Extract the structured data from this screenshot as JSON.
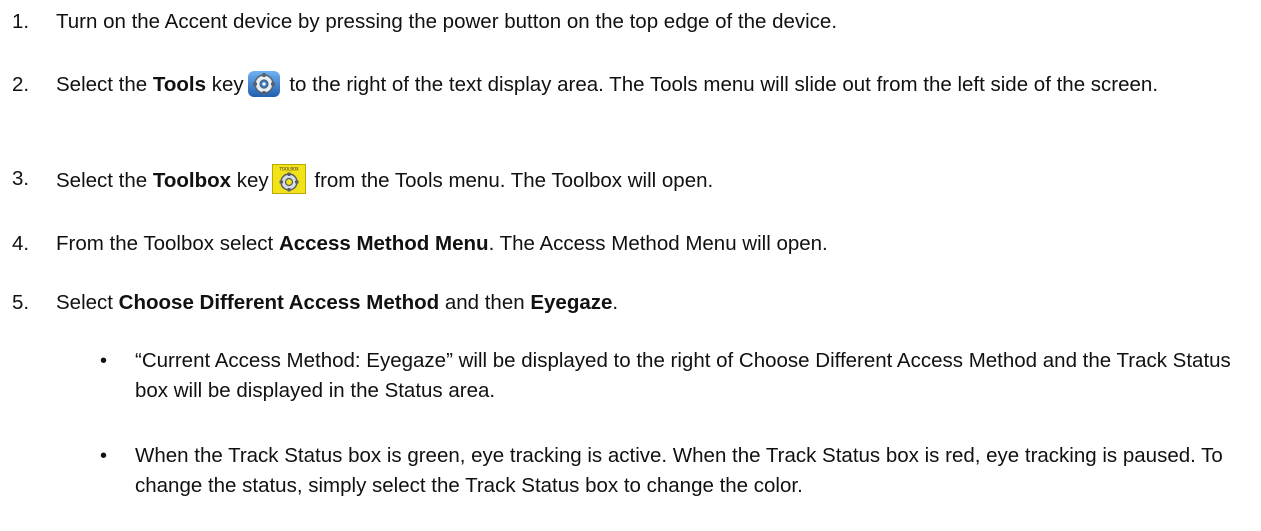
{
  "steps": [
    {
      "number": "1.",
      "text": "Turn on the Accent device by pressing the power button on the top edge of the device."
    },
    {
      "number": "2.",
      "pre": "Select the ",
      "bold": "Tools",
      "mid": " key",
      "icon": "tools-gear-icon",
      "post": " to the right of the text display area. The Tools menu will slide out from the left side of the screen."
    },
    {
      "number": "3.",
      "pre": "Select the ",
      "bold": "Toolbox",
      "mid": " key",
      "icon": "toolbox-key-icon",
      "icon_caption": "TOOLBOX",
      "post": " from the Tools menu. The Toolbox will open."
    },
    {
      "number": "4.",
      "pre": "From the Toolbox select ",
      "bold": "Access Method Menu",
      "post": ". The Access Method Menu will open."
    },
    {
      "number": "5.",
      "pre": "Select ",
      "bold": "Choose Different Access Method",
      "mid": " and then ",
      "bold2": "Eyegaze",
      "post": "."
    }
  ],
  "bullets": [
    "“Current Access Method: Eyegaze” will be displayed to the right of Choose Different Access Method and the Track Status box will be displayed in the Status area.",
    "When the Track Status box is green, eye tracking is active. When the Track Status box is red, eye tracking is paused. To change the status, simply select the Track Status box to change the color."
  ],
  "bullet_symbol": "•",
  "colors": {
    "text": "#111111",
    "tools_icon_blue": "#2f7fd0",
    "toolbox_icon_yellow": "#f2e21a"
  }
}
